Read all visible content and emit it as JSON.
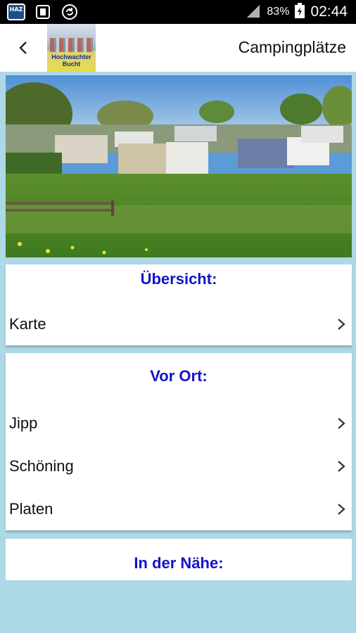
{
  "status_bar": {
    "app_icon_text": "HAZ",
    "battery": "83%",
    "time": "02:44"
  },
  "appbar": {
    "title": "Campingplätze",
    "logo_text": "Hochwachter Bucht"
  },
  "sections": [
    {
      "title": "Übersicht:",
      "items": [
        {
          "label": "Karte"
        }
      ]
    },
    {
      "title": "Vor Ort:",
      "items": [
        {
          "label": "Jipp"
        },
        {
          "label": "Schöning"
        },
        {
          "label": "Platen"
        }
      ]
    },
    {
      "title": "In der Nähe:",
      "items": []
    }
  ],
  "colors": {
    "background": "#add8e6",
    "section_title": "#1414c8"
  }
}
